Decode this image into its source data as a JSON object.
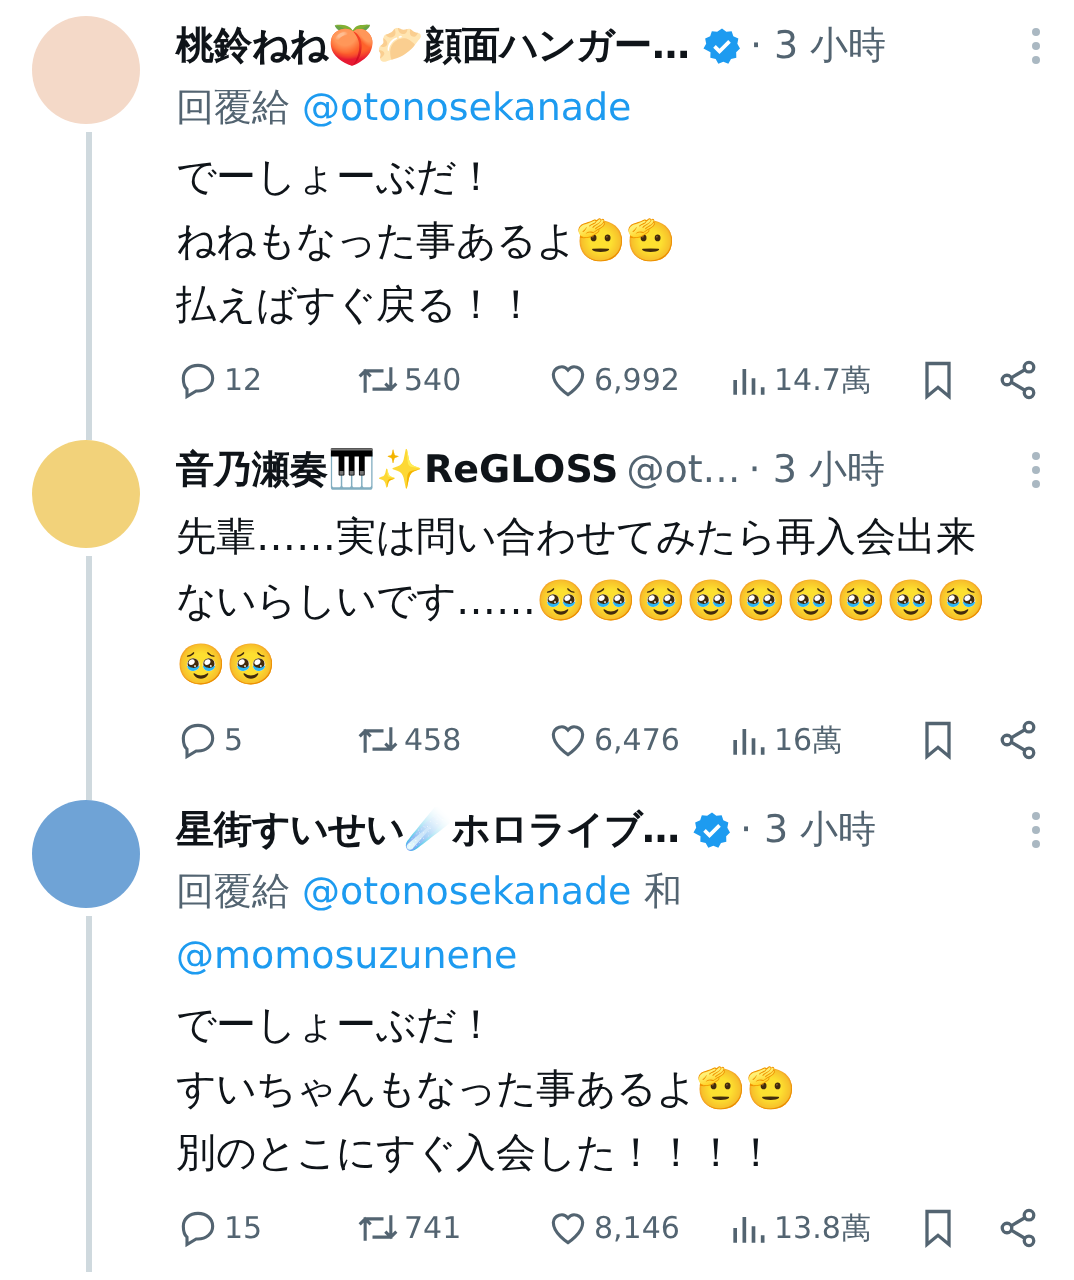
{
  "tweets": [
    {
      "name": "桃鈴ねね🍑🥟顔面ハンガー…",
      "verified": true,
      "separator": "·",
      "time": "3 小時",
      "reply_to": [
        {
          "kind": "label",
          "text": "回覆給"
        },
        {
          "kind": "mention",
          "text": "@otonosekanade"
        }
      ],
      "text_lines": [
        "でーしょーぶだ！",
        "ねねもなった事あるよ🫡🫡",
        "払えばすぐ戻る！！"
      ],
      "thread_above": false,
      "thread_below": true,
      "actions": {
        "replies": "12",
        "reposts": "540",
        "likes": "6,992",
        "views": "14.7萬"
      }
    },
    {
      "name": "音乃瀬奏🎹✨ReGLOSS",
      "handle": "@ot…",
      "verified": false,
      "separator": "·",
      "time": "3 小時",
      "text_lines": [
        "先輩……実は問い合わせてみたら再入会出来ないらしいです……🥹🥹🥹🥹🥹🥹🥹🥹🥹🥹🥹"
      ],
      "thread_above": true,
      "thread_below": true,
      "actions": {
        "replies": "5",
        "reposts": "458",
        "likes": "6,476",
        "views": "16萬"
      }
    },
    {
      "name": "星街すいせい☄️ホロライブ…",
      "verified": true,
      "separator": "·",
      "time": "3 小時",
      "reply_to": [
        {
          "kind": "label",
          "text": "回覆給"
        },
        {
          "kind": "mention",
          "text": "@otonosekanade"
        },
        {
          "kind": "label",
          "text": "和"
        },
        {
          "kind": "mention",
          "text": "@momosuzunene"
        }
      ],
      "text_lines": [
        "でーしょーぶだ！",
        "すいちゃんもなった事あるよ🫡🫡",
        "別のとこにすぐ入会した！！！！"
      ],
      "thread_above": true,
      "thread_below": true,
      "actions": {
        "replies": "15",
        "reposts": "741",
        "likes": "8,146",
        "views": "13.8萬"
      }
    }
  ]
}
